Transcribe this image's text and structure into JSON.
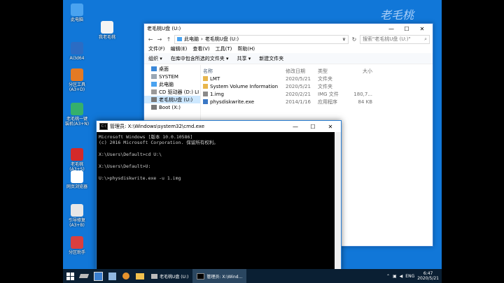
{
  "desktop": {
    "icons": [
      {
        "label": "此电脑",
        "color": "#4aa3f0"
      },
      {
        "label": "我老毛桃",
        "color": "#f4f4f4"
      },
      {
        "label": "Ai3d64",
        "color": "#2b6cc4"
      },
      {
        "label": "分区工具\n(A3+D)",
        "color": "#e47a24"
      },
      {
        "label": "老毛桃一键\n装机(A3+N)",
        "color": "#35b06c"
      },
      {
        "label": "老毛桃\n(A3+S)",
        "color": "#d42a2a"
      },
      {
        "label": "网页浏览器",
        "color": "#ffffff"
      },
      {
        "label": "引导修复\n(A3+B)",
        "color": "#e7e7e7"
      },
      {
        "label": "分区助手",
        "color": "#d93f3f"
      }
    ],
    "deco_text": "老毛桃"
  },
  "explorer": {
    "title": "老毛桃U盘 (U:)",
    "address": [
      "此电脑",
      "老毛桃U盘 (U:)"
    ],
    "search_placeholder": "搜索\"老毛桃U盘 (U:)\"",
    "menu": [
      "文件(F)",
      "编辑(E)",
      "查看(V)",
      "工具(T)",
      "帮助(H)"
    ],
    "commands": [
      "组织 ▾",
      "在库中包含所选的文件夹 ▾",
      "共享 ▾",
      "新建文件夹"
    ],
    "nav": [
      {
        "label": "桌面",
        "color": "#3a87d8",
        "selected": false
      },
      {
        "label": "SYSTEM",
        "color": "#9aa7b5",
        "selected": false
      },
      {
        "label": "此电脑",
        "color": "#4aa3f0",
        "selected": false
      },
      {
        "label": "CD 驱动器 (D:) LI",
        "color": "#999999",
        "selected": false
      },
      {
        "label": "老毛桃U盘 (U:)",
        "color": "#777777",
        "selected": true
      },
      {
        "label": "Boot (X:)",
        "color": "#777777",
        "selected": false
      }
    ],
    "columns": [
      "名称",
      "修改日期",
      "类型",
      "大小"
    ],
    "files": [
      {
        "name": "LMT",
        "date": "2020/5/21",
        "type": "文件夹",
        "size": "",
        "color": "#e8b64c"
      },
      {
        "name": "System Volume Information",
        "date": "2020/5/21",
        "type": "文件夹",
        "size": "",
        "color": "#e8b64c"
      },
      {
        "name": "1.img",
        "date": "2020/2/21",
        "type": "IMG 文件",
        "size": "180,7...",
        "color": "#8a8a8a"
      },
      {
        "name": "physdiskwrite.exe",
        "date": "2014/1/16",
        "type": "应用程序",
        "size": "84 KB",
        "color": "#3b78c5"
      }
    ]
  },
  "cmd": {
    "title": "管理员: X:\\Windows\\system32\\cmd.exe",
    "icon_text": "C:\\",
    "lines": [
      "Microsoft Windows [版本 10.0.10586]",
      "(c) 2016 Microsoft Corporation. 保留所有权利。",
      "",
      "X:\\Users\\Default>cd U:\\",
      "",
      "X:\\Users\\Default>U:",
      "",
      "U:\\>physdiskwrite.exe -u 1.img"
    ]
  },
  "taskbar": {
    "apps": [
      {
        "label": "老毛桃U盘 (U:)",
        "active": false
      },
      {
        "label": "管理员: X:\\Wind...",
        "active": true
      }
    ],
    "lang": "ENG",
    "time": "6:47",
    "date": "2020/5/21"
  }
}
